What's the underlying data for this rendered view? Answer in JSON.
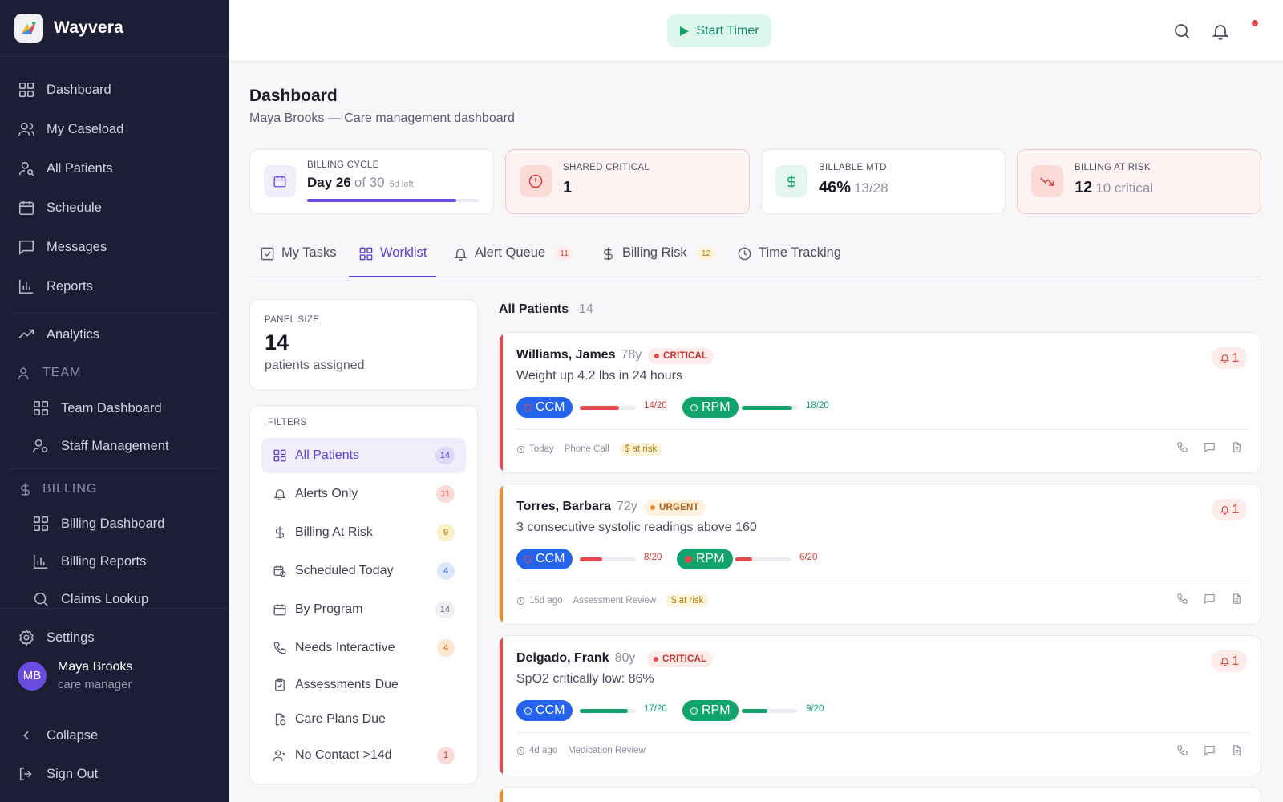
{
  "brand": {
    "name": "Wayvera"
  },
  "sidebar": {
    "items": [
      {
        "label": "Dashboard"
      },
      {
        "label": "My Caseload"
      },
      {
        "label": "All Patients"
      },
      {
        "label": "Schedule"
      },
      {
        "label": "Messages"
      },
      {
        "label": "Reports"
      },
      {
        "label": "Analytics"
      }
    ],
    "team": {
      "heading": "TEAM",
      "items": [
        {
          "label": "Team Dashboard"
        },
        {
          "label": "Staff Management"
        }
      ]
    },
    "billing": {
      "heading": "BILLING",
      "items": [
        {
          "label": "Billing Dashboard"
        },
        {
          "label": "Billing Reports"
        },
        {
          "label": "Claims Lookup"
        }
      ]
    },
    "settings_label": "Settings",
    "user": {
      "initials": "MB",
      "name": "Maya Brooks",
      "role": "care manager"
    },
    "collapse_label": "Collapse",
    "signout_label": "Sign Out"
  },
  "topbar": {
    "timer_label": "Start Timer"
  },
  "header": {
    "title": "Dashboard",
    "subtitle": "Maya Brooks — Care management dashboard"
  },
  "stats": {
    "billing_cycle": {
      "label": "BILLING CYCLE",
      "value": "Day 26",
      "of": "of 30",
      "left": "5d left",
      "progress": 0.867
    },
    "shared_critical": {
      "label": "SHARED CRITICAL",
      "value": "1"
    },
    "billable_mtd": {
      "label": "BILLABLE MTD",
      "value": "46%",
      "detail": "13/28"
    },
    "billing_at_risk": {
      "label": "BILLING AT RISK",
      "value": "12",
      "detail": "10 critical"
    }
  },
  "tabs": [
    {
      "label": "My Tasks"
    },
    {
      "label": "Worklist"
    },
    {
      "label": "Alert Queue",
      "badge": "11"
    },
    {
      "label": "Billing Risk",
      "badge": "12"
    },
    {
      "label": "Time Tracking"
    }
  ],
  "panel": {
    "label": "PANEL SIZE",
    "value": "14",
    "sub": "patients assigned"
  },
  "filters": {
    "heading": "FILTERS",
    "items": [
      {
        "label": "All Patients",
        "count": "14"
      },
      {
        "label": "Alerts Only",
        "count": "11"
      },
      {
        "label": "Billing At Risk",
        "count": "9"
      },
      {
        "label": "Scheduled Today",
        "count": "4"
      },
      {
        "label": "By Program",
        "count": "14"
      },
      {
        "label": "Needs Interactive",
        "count": "4"
      },
      {
        "label": "Assessments Due",
        "count": ""
      },
      {
        "label": "Care Plans Due",
        "count": ""
      },
      {
        "label": "No Contact >14d",
        "count": "1"
      }
    ]
  },
  "list": {
    "title": "All Patients",
    "count": "14"
  },
  "patients": [
    {
      "name": "Williams, James",
      "age": "78y",
      "status": "CRITICAL",
      "reason": "Weight up 4.2 lbs in 24 hours",
      "alerts": "1",
      "ccm": {
        "label": "CCM",
        "value": "14/20",
        "progress": 0.7
      },
      "rpm": {
        "label": "RPM",
        "value": "18/20",
        "progress": 0.9
      },
      "last": "Today",
      "type": "Phone Call",
      "risk": "$ at risk"
    },
    {
      "name": "Torres, Barbara",
      "age": "72y",
      "status": "URGENT",
      "reason": "3 consecutive systolic readings above 160",
      "alerts": "1",
      "ccm": {
        "label": "CCM",
        "value": "8/20",
        "progress": 0.4
      },
      "rpm": {
        "label": "RPM",
        "value": "6/20",
        "progress": 0.3
      },
      "last": "15d ago",
      "type": "Assessment Review",
      "risk": "$ at risk"
    },
    {
      "name": "Delgado, Frank",
      "age": "80y",
      "status": "CRITICAL",
      "reason": "SpO2 critically low: 86%",
      "alerts": "1",
      "ccm": {
        "label": "CCM",
        "value": "17/20",
        "progress": 0.85
      },
      "rpm": {
        "label": "RPM",
        "value": "9/20",
        "progress": 0.45
      },
      "last": "4d ago",
      "type": "Medication Review",
      "risk": ""
    }
  ],
  "colors": {
    "accent": "#5b42d6",
    "sidebar_bg": "#1d1d36",
    "critical": "#e5484d",
    "urgent": "#f08c2a",
    "ccm": "#2563eb",
    "rpm": "#12a36c"
  }
}
